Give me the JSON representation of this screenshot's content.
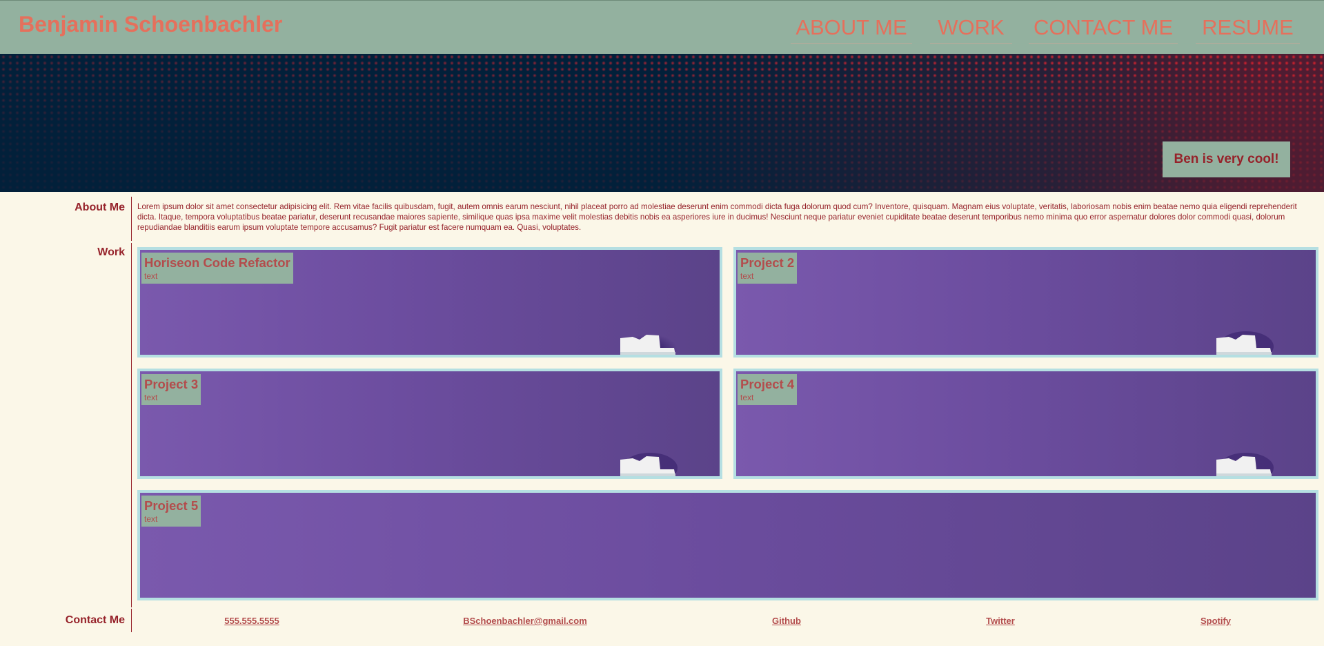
{
  "header": {
    "site_title": "Benjamin Schoenbachler",
    "nav": [
      {
        "label": "ABOUT ME"
      },
      {
        "label": "WORK"
      },
      {
        "label": "CONTACT ME"
      },
      {
        "label": "RESUME"
      }
    ]
  },
  "hero": {
    "badge": "Ben is very cool!",
    "dot_color": "#ff2832",
    "background_color": "#02203a"
  },
  "about": {
    "label": "About Me",
    "text": "Lorem ipsum dolor sit amet consectetur adipisicing elit. Rem vitae facilis quibusdam, fugit, autem omnis earum nesciunt, nihil placeat porro ad molestiae deserunt enim commodi dicta fuga dolorum quod cum? Inventore, quisquam. Magnam eius voluptate, veritatis, laboriosam nobis enim beatae nemo quia eligendi reprehenderit dicta. Itaque, tempora voluptatibus beatae pariatur, deserunt recusandae maiores sapiente, similique quas ipsa maxime velit molestias debitis nobis ea asperiores iure in ducimus! Nesciunt neque pariatur eveniet cupiditate beatae deserunt temporibus nemo minima quo error aspernatur dolores dolor commodi quasi, dolorum repudiandae blanditiis earum ipsum voluptate tempore accusamus? Fugit pariatur est facere numquam ea. Quasi, voluptates."
  },
  "work": {
    "label": "Work",
    "projects": [
      {
        "title": "Horiseon Code Refactor",
        "text": "text"
      },
      {
        "title": "Project 2",
        "text": "text"
      },
      {
        "title": "Project 3",
        "text": "text"
      },
      {
        "title": "Project 4",
        "text": "text"
      },
      {
        "title": "Project 5",
        "text": "text"
      }
    ]
  },
  "contact": {
    "label": "Contact Me",
    "links": [
      {
        "label": "555.555.5555"
      },
      {
        "label": "BSchoenbachler@gmail.com"
      },
      {
        "label": "Github"
      },
      {
        "label": "Twitter"
      },
      {
        "label": "Spotify"
      }
    ]
  },
  "colors": {
    "header_bg": "#93b19f",
    "accent_text": "#e5705c",
    "dark_red": "#96222a",
    "page_bg": "#fbf7e8",
    "card_border": "#b5dfe2",
    "card_purple": "#6c4d9f"
  }
}
